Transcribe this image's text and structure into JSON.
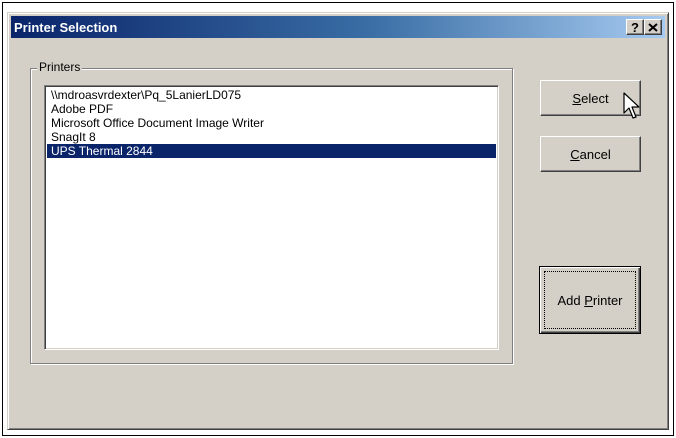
{
  "window": {
    "title": "Printer Selection",
    "help_label": "?",
    "close_label": "✕"
  },
  "printers": {
    "group_label": "Printers",
    "items": [
      {
        "label": "\\\\mdroasvrdexter\\Pq_5LanierLD075",
        "selected": false
      },
      {
        "label": "Adobe PDF",
        "selected": false
      },
      {
        "label": "Microsoft Office Document Image Writer",
        "selected": false
      },
      {
        "label": "SnagIt 8",
        "selected": false
      },
      {
        "label": "UPS Thermal 2844",
        "selected": true
      }
    ]
  },
  "buttons": {
    "select": {
      "mnemonic": "S",
      "rest": "elect"
    },
    "cancel": {
      "mnemonic": "C",
      "rest": "ancel"
    },
    "add_printer": {
      "prefix": "Add ",
      "mnemonic": "P",
      "rest": "rinter"
    }
  },
  "colors": {
    "titlebar_start": "#0a246a",
    "titlebar_end": "#a6caf0",
    "selection": "#0a246a",
    "face": "#d4d0c8"
  }
}
